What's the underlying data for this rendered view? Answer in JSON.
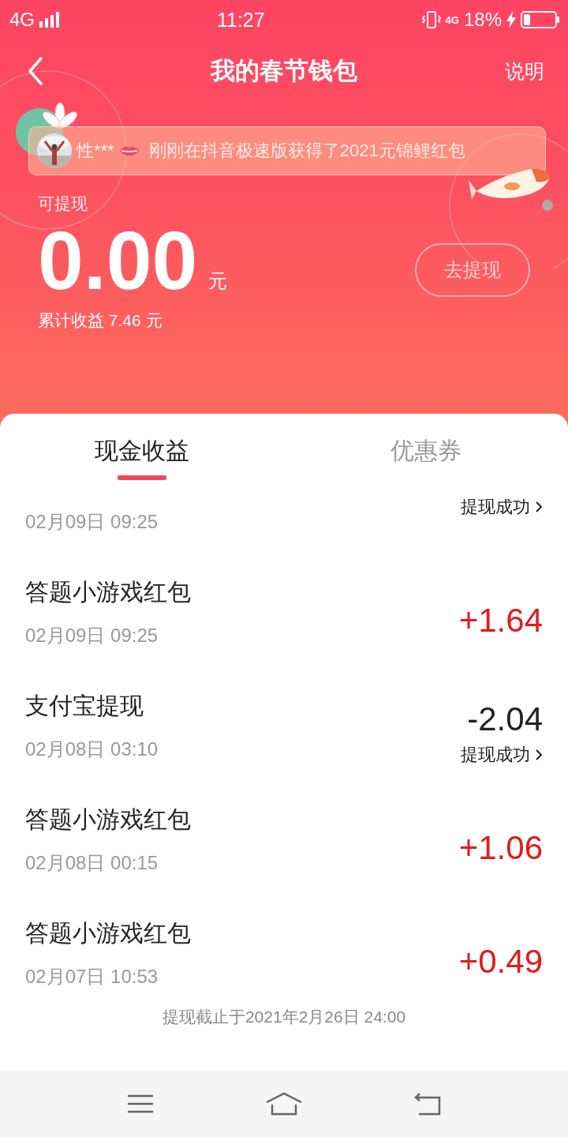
{
  "status_bar": {
    "network": "4G",
    "time": "11:27",
    "network_small": "4G",
    "battery": "18%"
  },
  "header": {
    "title": "我的春节钱包",
    "action": "说明"
  },
  "ticker": {
    "user": "性***",
    "message": "刚刚在抖音极速版获得了2021元锦鲤红包"
  },
  "balance": {
    "label": "可提现",
    "amount": "0.00",
    "unit": "元",
    "total": "累计收益 7.46 元",
    "button": {
      "label": "去提现",
      "disabled": true
    }
  },
  "tabs": [
    {
      "label": "现金收益",
      "selected": true
    },
    {
      "label": "优惠券",
      "selected": false
    }
  ],
  "transactions": [
    {
      "kind": "withdrawal",
      "date": "02月09日 09:25",
      "status": "提现成功"
    },
    {
      "kind": "income",
      "title": "答题小游戏红包",
      "date": "02月09日 09:25",
      "amount": "+1.64"
    },
    {
      "kind": "withdrawal",
      "title": "支付宝提现",
      "date": "02月08日 03:10",
      "amount": "-2.04",
      "status": "提现成功"
    },
    {
      "kind": "income",
      "title": "答题小游戏红包",
      "date": "02月08日 00:15",
      "amount": "+1.06"
    },
    {
      "kind": "income",
      "title": "答题小游戏红包",
      "date": "02月07日 10:53",
      "amount": "+0.49"
    }
  ],
  "footer_note": "提现截止于2021年2月26日 24:00"
}
